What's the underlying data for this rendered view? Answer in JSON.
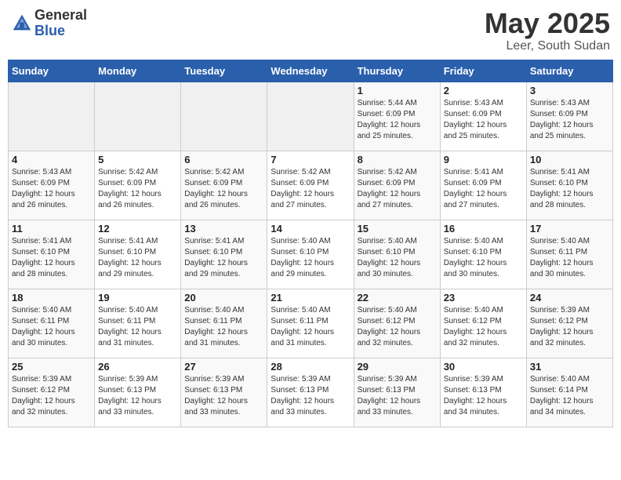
{
  "header": {
    "logo_general": "General",
    "logo_blue": "Blue",
    "month_title": "May 2025",
    "location": "Leer, South Sudan"
  },
  "calendar": {
    "days_of_week": [
      "Sunday",
      "Monday",
      "Tuesday",
      "Wednesday",
      "Thursday",
      "Friday",
      "Saturday"
    ],
    "weeks": [
      [
        {
          "day": "",
          "info": "",
          "empty": true
        },
        {
          "day": "",
          "info": "",
          "empty": true
        },
        {
          "day": "",
          "info": "",
          "empty": true
        },
        {
          "day": "",
          "info": "",
          "empty": true
        },
        {
          "day": "1",
          "info": "Sunrise: 5:44 AM\nSunset: 6:09 PM\nDaylight: 12 hours\nand 25 minutes.",
          "empty": false
        },
        {
          "day": "2",
          "info": "Sunrise: 5:43 AM\nSunset: 6:09 PM\nDaylight: 12 hours\nand 25 minutes.",
          "empty": false
        },
        {
          "day": "3",
          "info": "Sunrise: 5:43 AM\nSunset: 6:09 PM\nDaylight: 12 hours\nand 25 minutes.",
          "empty": false
        }
      ],
      [
        {
          "day": "4",
          "info": "Sunrise: 5:43 AM\nSunset: 6:09 PM\nDaylight: 12 hours\nand 26 minutes.",
          "empty": false
        },
        {
          "day": "5",
          "info": "Sunrise: 5:42 AM\nSunset: 6:09 PM\nDaylight: 12 hours\nand 26 minutes.",
          "empty": false
        },
        {
          "day": "6",
          "info": "Sunrise: 5:42 AM\nSunset: 6:09 PM\nDaylight: 12 hours\nand 26 minutes.",
          "empty": false
        },
        {
          "day": "7",
          "info": "Sunrise: 5:42 AM\nSunset: 6:09 PM\nDaylight: 12 hours\nand 27 minutes.",
          "empty": false
        },
        {
          "day": "8",
          "info": "Sunrise: 5:42 AM\nSunset: 6:09 PM\nDaylight: 12 hours\nand 27 minutes.",
          "empty": false
        },
        {
          "day": "9",
          "info": "Sunrise: 5:41 AM\nSunset: 6:09 PM\nDaylight: 12 hours\nand 27 minutes.",
          "empty": false
        },
        {
          "day": "10",
          "info": "Sunrise: 5:41 AM\nSunset: 6:10 PM\nDaylight: 12 hours\nand 28 minutes.",
          "empty": false
        }
      ],
      [
        {
          "day": "11",
          "info": "Sunrise: 5:41 AM\nSunset: 6:10 PM\nDaylight: 12 hours\nand 28 minutes.",
          "empty": false
        },
        {
          "day": "12",
          "info": "Sunrise: 5:41 AM\nSunset: 6:10 PM\nDaylight: 12 hours\nand 29 minutes.",
          "empty": false
        },
        {
          "day": "13",
          "info": "Sunrise: 5:41 AM\nSunset: 6:10 PM\nDaylight: 12 hours\nand 29 minutes.",
          "empty": false
        },
        {
          "day": "14",
          "info": "Sunrise: 5:40 AM\nSunset: 6:10 PM\nDaylight: 12 hours\nand 29 minutes.",
          "empty": false
        },
        {
          "day": "15",
          "info": "Sunrise: 5:40 AM\nSunset: 6:10 PM\nDaylight: 12 hours\nand 30 minutes.",
          "empty": false
        },
        {
          "day": "16",
          "info": "Sunrise: 5:40 AM\nSunset: 6:10 PM\nDaylight: 12 hours\nand 30 minutes.",
          "empty": false
        },
        {
          "day": "17",
          "info": "Sunrise: 5:40 AM\nSunset: 6:11 PM\nDaylight: 12 hours\nand 30 minutes.",
          "empty": false
        }
      ],
      [
        {
          "day": "18",
          "info": "Sunrise: 5:40 AM\nSunset: 6:11 PM\nDaylight: 12 hours\nand 30 minutes.",
          "empty": false
        },
        {
          "day": "19",
          "info": "Sunrise: 5:40 AM\nSunset: 6:11 PM\nDaylight: 12 hours\nand 31 minutes.",
          "empty": false
        },
        {
          "day": "20",
          "info": "Sunrise: 5:40 AM\nSunset: 6:11 PM\nDaylight: 12 hours\nand 31 minutes.",
          "empty": false
        },
        {
          "day": "21",
          "info": "Sunrise: 5:40 AM\nSunset: 6:11 PM\nDaylight: 12 hours\nand 31 minutes.",
          "empty": false
        },
        {
          "day": "22",
          "info": "Sunrise: 5:40 AM\nSunset: 6:12 PM\nDaylight: 12 hours\nand 32 minutes.",
          "empty": false
        },
        {
          "day": "23",
          "info": "Sunrise: 5:40 AM\nSunset: 6:12 PM\nDaylight: 12 hours\nand 32 minutes.",
          "empty": false
        },
        {
          "day": "24",
          "info": "Sunrise: 5:39 AM\nSunset: 6:12 PM\nDaylight: 12 hours\nand 32 minutes.",
          "empty": false
        }
      ],
      [
        {
          "day": "25",
          "info": "Sunrise: 5:39 AM\nSunset: 6:12 PM\nDaylight: 12 hours\nand 32 minutes.",
          "empty": false
        },
        {
          "day": "26",
          "info": "Sunrise: 5:39 AM\nSunset: 6:13 PM\nDaylight: 12 hours\nand 33 minutes.",
          "empty": false
        },
        {
          "day": "27",
          "info": "Sunrise: 5:39 AM\nSunset: 6:13 PM\nDaylight: 12 hours\nand 33 minutes.",
          "empty": false
        },
        {
          "day": "28",
          "info": "Sunrise: 5:39 AM\nSunset: 6:13 PM\nDaylight: 12 hours\nand 33 minutes.",
          "empty": false
        },
        {
          "day": "29",
          "info": "Sunrise: 5:39 AM\nSunset: 6:13 PM\nDaylight: 12 hours\nand 33 minutes.",
          "empty": false
        },
        {
          "day": "30",
          "info": "Sunrise: 5:39 AM\nSunset: 6:13 PM\nDaylight: 12 hours\nand 34 minutes.",
          "empty": false
        },
        {
          "day": "31",
          "info": "Sunrise: 5:40 AM\nSunset: 6:14 PM\nDaylight: 12 hours\nand 34 minutes.",
          "empty": false
        }
      ]
    ]
  }
}
